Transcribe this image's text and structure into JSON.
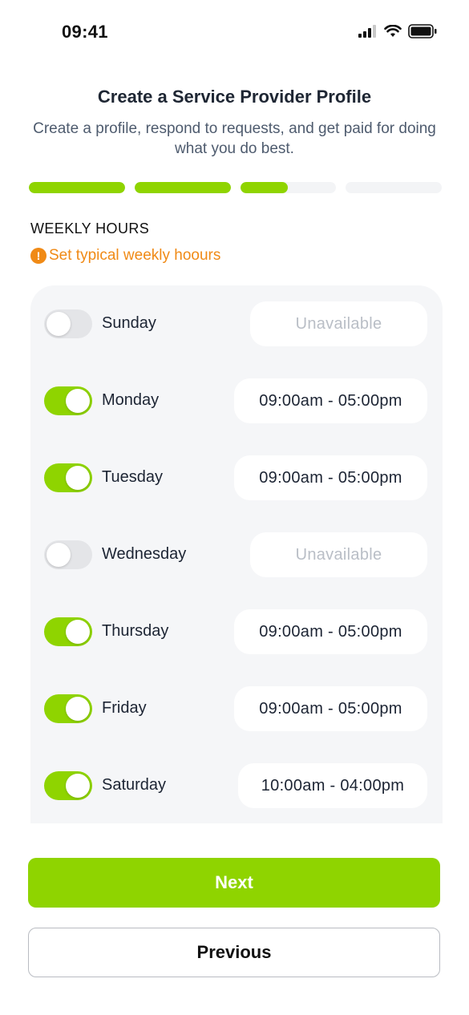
{
  "status_bar": {
    "time": "09:41",
    "icons": [
      "cellular-signal-icon",
      "wifi-icon",
      "battery-icon"
    ]
  },
  "header": {
    "title": "Create a Service Provider Profile",
    "subtitle": "Create a profile, respond to requests, and get paid for doing what you do best."
  },
  "progress": {
    "segments": [
      1,
      1,
      0.5,
      0
    ],
    "fill_color": "#8fd400",
    "track_color": "#f3f4f6"
  },
  "section": {
    "title": "WEEKLY HOURS",
    "hint": "Set typical weekly hoours",
    "hint_icon": "!"
  },
  "days": [
    {
      "name": "Sunday",
      "enabled": false,
      "hours": "Unavailable"
    },
    {
      "name": "Monday",
      "enabled": true,
      "hours": "09:00am - 05:00pm"
    },
    {
      "name": "Tuesday",
      "enabled": true,
      "hours": "09:00am - 05:00pm"
    },
    {
      "name": "Wednesday",
      "enabled": false,
      "hours": "Unavailable"
    },
    {
      "name": "Thursday",
      "enabled": true,
      "hours": "09:00am - 05:00pm"
    },
    {
      "name": "Friday",
      "enabled": true,
      "hours": "09:00am - 05:00pm"
    },
    {
      "name": "Saturday",
      "enabled": true,
      "hours": "10:00am - 04:00pm"
    }
  ],
  "buttons": {
    "next": "Next",
    "previous": "Previous"
  },
  "colors": {
    "accent": "#8fd400",
    "warning": "#f08a16",
    "card_bg": "#f5f6f8"
  }
}
